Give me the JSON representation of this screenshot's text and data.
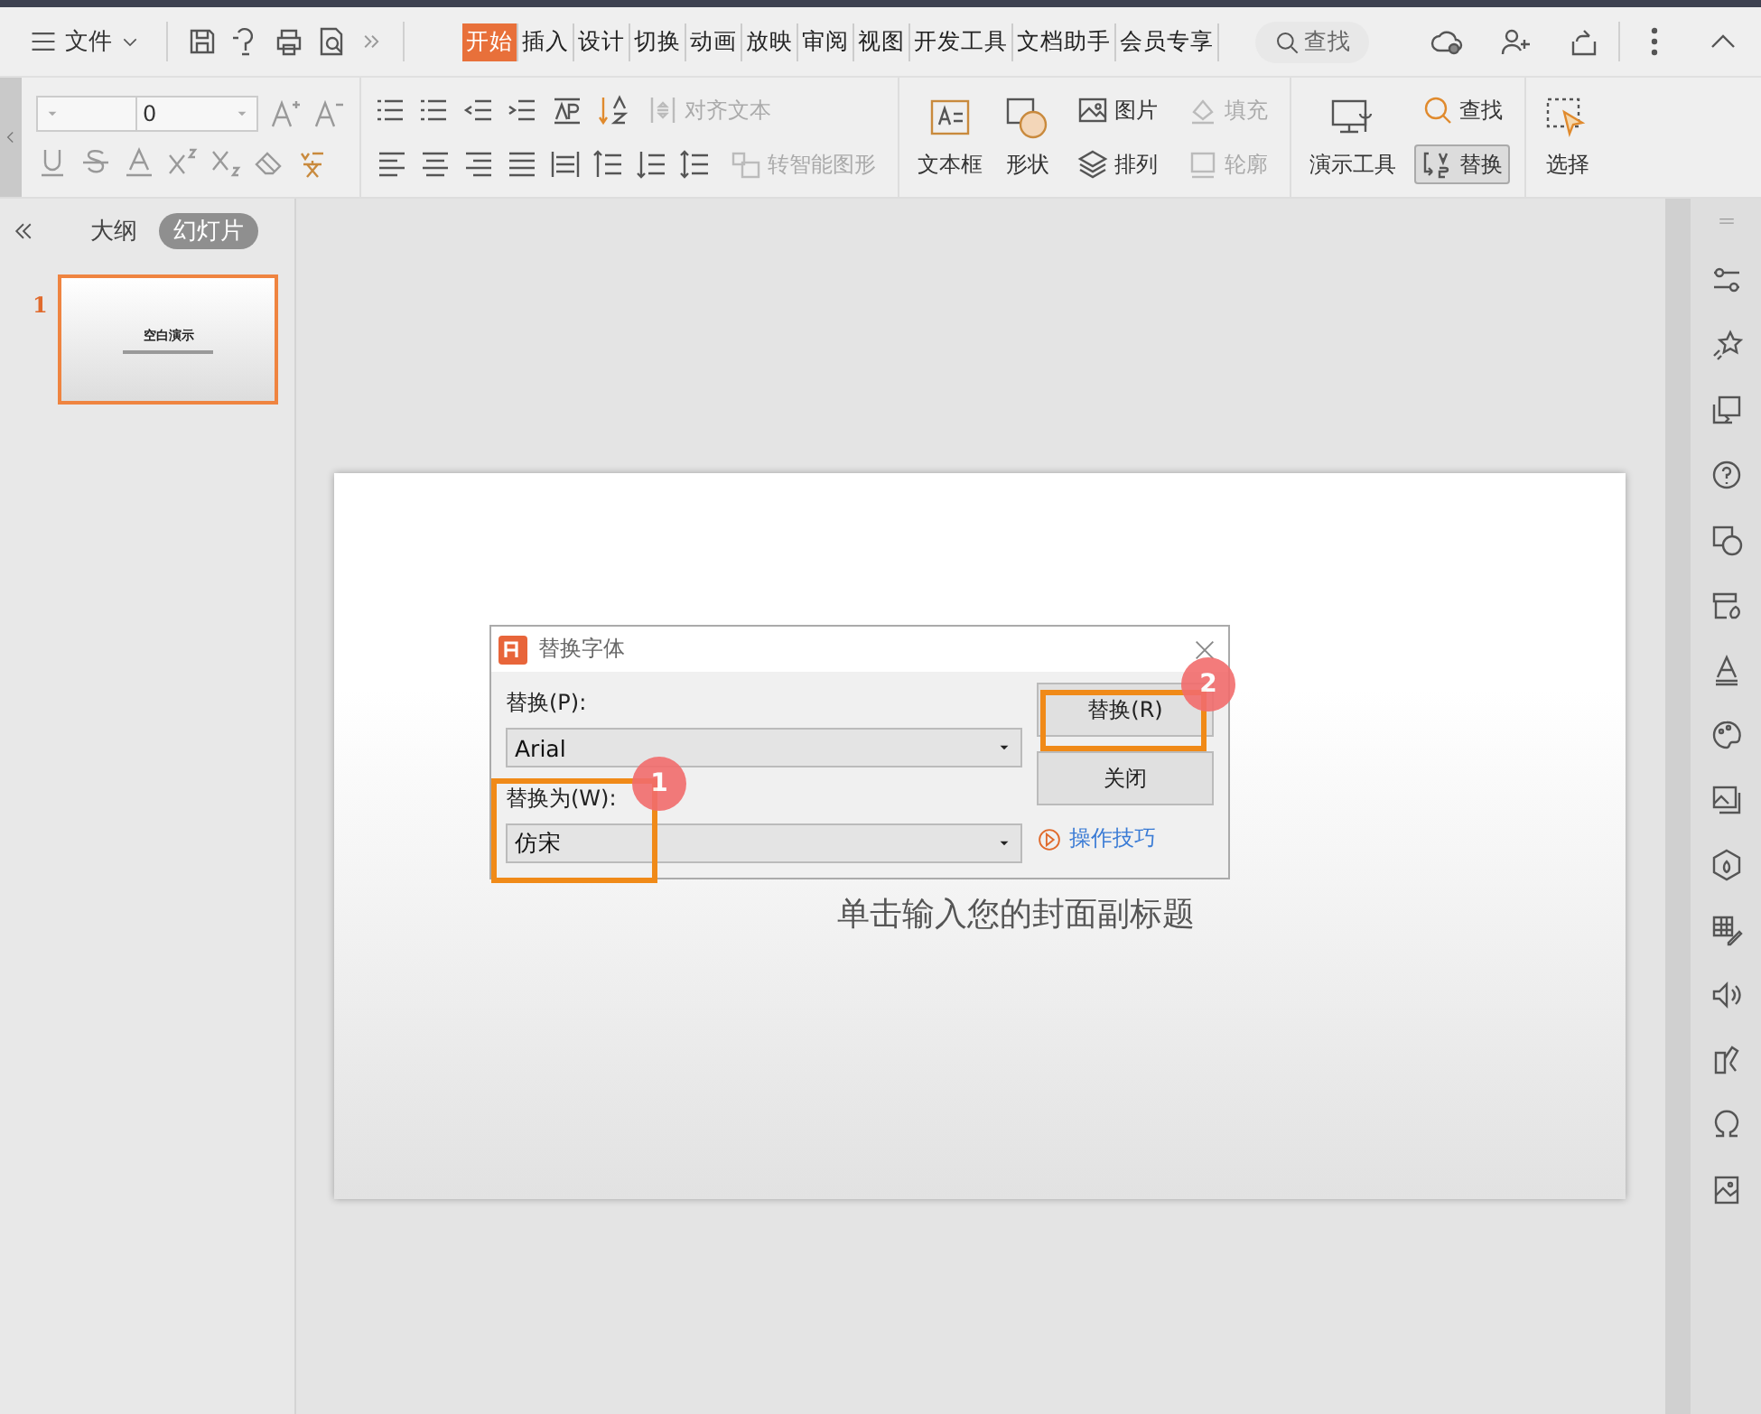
{
  "menu": {
    "file": "文件",
    "tabs": [
      {
        "label": "开始",
        "selected": true
      },
      {
        "label": "插入",
        "selected": false
      },
      {
        "label": "设计",
        "selected": false
      },
      {
        "label": "切换",
        "selected": false
      },
      {
        "label": "动画",
        "selected": false
      },
      {
        "label": "放映",
        "selected": false
      },
      {
        "label": "审阅",
        "selected": false
      },
      {
        "label": "视图",
        "selected": false
      },
      {
        "label": "开发工具",
        "selected": false
      },
      {
        "label": "文档助手",
        "selected": false
      },
      {
        "label": "会员专享",
        "selected": false
      }
    ],
    "search": "查找"
  },
  "ribbon": {
    "font_size": "0",
    "items": [
      {
        "kind": "small",
        "label": "对齐文本",
        "disabled": true
      },
      {
        "kind": "small",
        "label": "转智能图形",
        "disabled": true
      },
      {
        "kind": "large",
        "label": "文本框",
        "disabled": false
      },
      {
        "kind": "large",
        "label": "形状",
        "disabled": false
      },
      {
        "kind": "small",
        "label": "图片",
        "disabled": false
      },
      {
        "kind": "small",
        "label": "排列",
        "disabled": false
      },
      {
        "kind": "small",
        "label": "填充",
        "disabled": true
      },
      {
        "kind": "small",
        "label": "轮廓",
        "disabled": true
      },
      {
        "kind": "large",
        "label": "演示工具",
        "disabled": false
      },
      {
        "kind": "small",
        "label": "查找",
        "disabled": false,
        "selected": false
      },
      {
        "kind": "small",
        "label": "替换",
        "disabled": false,
        "selected": true
      },
      {
        "kind": "large",
        "label": "选择",
        "disabled": false
      }
    ]
  },
  "panel": {
    "tabs": [
      {
        "label": "大纲",
        "selected": false
      },
      {
        "label": "幻灯片",
        "selected": true
      }
    ],
    "slides": [
      {
        "number": "1",
        "title": "空白演示",
        "selected": true
      }
    ]
  },
  "slide": {
    "subtitle": "单击输入您的封面副标题"
  },
  "dialog": {
    "title": "替换字体",
    "replace_label": "替换(P):",
    "replace_value": "Arial",
    "with_label": "替换为(W):",
    "with_value": "仿宋",
    "buttons": [
      {
        "label": "替换(R)"
      },
      {
        "label": "关闭"
      }
    ],
    "link": "操作技巧"
  },
  "annotations": [
    {
      "number": "1"
    },
    {
      "number": "2"
    }
  ]
}
